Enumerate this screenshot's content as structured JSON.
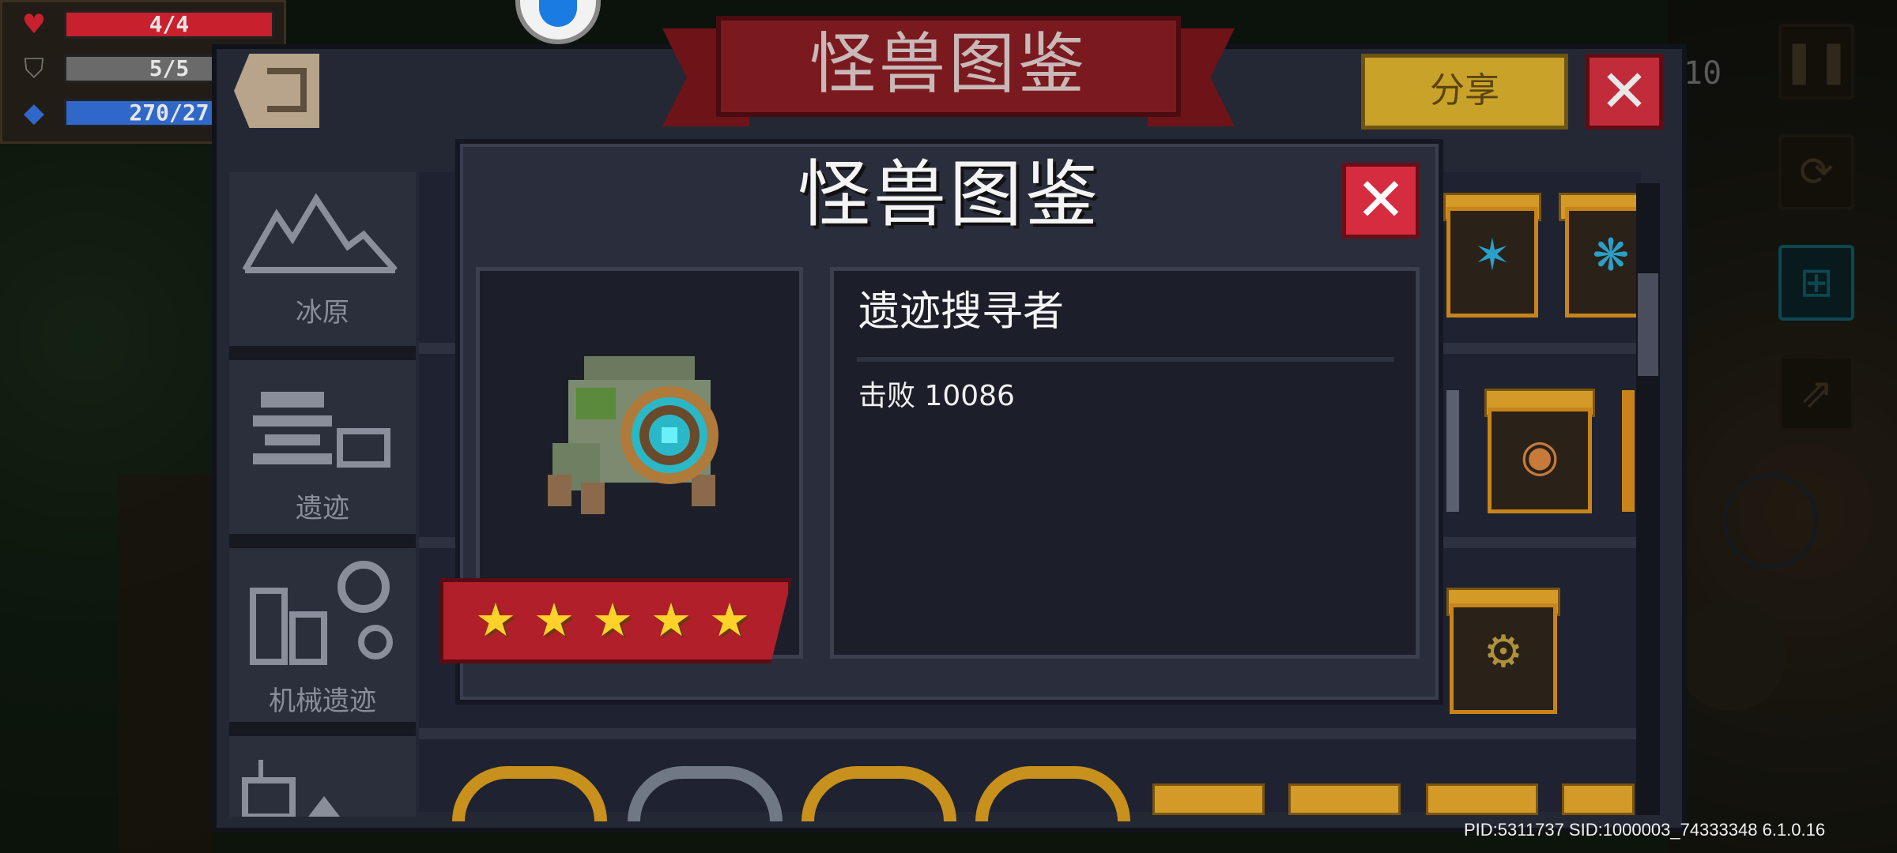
{
  "hud": {
    "hp": "4/4",
    "armor": "5/5",
    "energy": "270/27",
    "hp_color": "#c8202c",
    "armor_color": "#6a6a6a",
    "energy_color": "#2f68c8"
  },
  "top_right": {
    "level_text": "10"
  },
  "atlas": {
    "header_title": "怪兽图鉴",
    "share_label": "分享",
    "close_symbol": "✕",
    "categories": [
      {
        "label": "冰原",
        "icon": "mountain-icon"
      },
      {
        "label": "遗迹",
        "icon": "ruins-icon"
      },
      {
        "label": "机械遗迹",
        "icon": "mechanical-ruins-icon"
      },
      {
        "label": "",
        "icon": "castle-icon"
      }
    ]
  },
  "detail": {
    "title": "怪兽图鉴",
    "close_symbol": "✕",
    "monster_name": "遗迹搜寻者",
    "kills_text": "击败 10086",
    "star_rating": 5,
    "star_max": 5,
    "monster_icon": "ruin-seeker-sprite"
  },
  "footer": {
    "pid_text": "PID:5311737 SID:1000003_74333348 6.1.0.16"
  },
  "colors": {
    "ribbon_red": "#7a1a1f",
    "share_gold": "#c9a22a",
    "close_red": "#d62c40",
    "star_gold": "#ffd22a",
    "panel_bg": "#242734"
  }
}
